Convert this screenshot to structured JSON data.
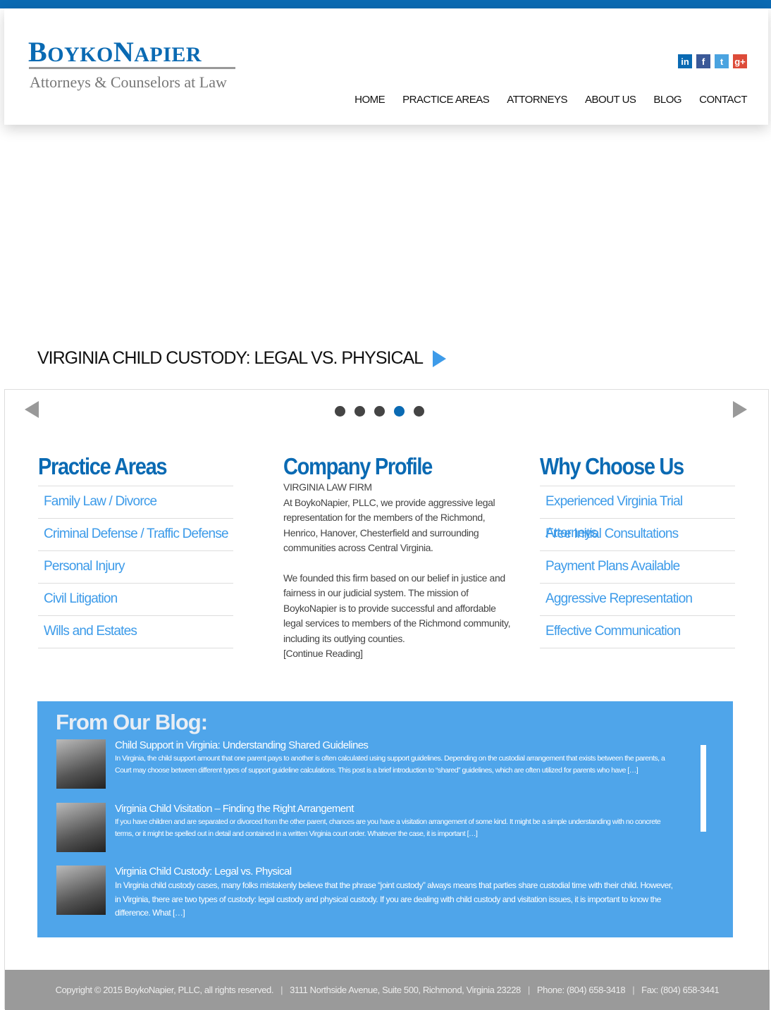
{
  "logo": {
    "name_b": "B",
    "name_oyko": "OYKO",
    "name_n": "N",
    "name_apier": "APIER",
    "tagline": "Attorneys & Counselors at Law"
  },
  "social": [
    {
      "name": "linkedin",
      "glyph": "in",
      "color": "#0a6ab3"
    },
    {
      "name": "facebook",
      "glyph": "f",
      "color": "#3b5998"
    },
    {
      "name": "twitter",
      "glyph": "t",
      "color": "#4aa3e0"
    },
    {
      "name": "google-plus",
      "glyph": "g+",
      "color": "#dd4b39"
    }
  ],
  "nav": [
    "HOME",
    "PRACTICE AREAS",
    "ATTORNEYS",
    "ABOUT US",
    "BLOG",
    "CONTACT"
  ],
  "slide": {
    "title": "VIRGINIA CHILD CUSTODY: LEGAL VS. PHYSICAL",
    "active_dot": 4,
    "dot_count": 5
  },
  "practice": {
    "title": "Practice Areas",
    "items": [
      "Family Law / Divorce",
      "Criminal Defense / Traffic Defense",
      "Personal Injury",
      "Civil Litigation",
      "Wills and Estates"
    ]
  },
  "profile": {
    "title": "Company Profile",
    "subtitle": "VIRGINIA LAW FIRM",
    "p1": "At BoykoNapier, PLLC, we provide aggressive legal representation for the members of the Richmond, Henrico, Hanover, Chesterfield and surrounding communities across Central Virginia.",
    "p2": "We founded this firm based on our belief in justice and fairness in our judicial system.  The mission of BoykoNapier is to provide successful and affordable legal services to members of the Richmond community, including its outlying counties.",
    "more": "[Continue Reading]"
  },
  "why": {
    "title": "Why Choose Us",
    "items": [
      "Experienced Virginia Trial Attorneys",
      "Free Initial Consultations",
      "Payment Plans Available",
      "Aggressive Representation",
      "Effective Communication"
    ]
  },
  "blog": {
    "title": "From Our Blog:",
    "posts": [
      {
        "title": "Child Support in Virginia: Understanding Shared Guidelines",
        "excerpt": "In Virginia, the child support amount that one parent pays to another is often calculated using support guidelines.  Depending on the custodial arrangement that exists between the parents, a Court may choose between different types of support guideline calculations. This post is a brief introduction to “shared” guidelines, which are often utilized for parents who have […]"
      },
      {
        "title": "Virginia Child Visitation – Finding the Right Arrangement",
        "excerpt": "If you have children and are separated or divorced from the other parent, chances are you have a visitation arrangement of some kind. It might be a simple understanding with no concrete terms, or it might be spelled out in detail and contained in a written Virginia court order. Whatever the case, it is important […]"
      },
      {
        "title": "Virginia Child Custody: Legal vs. Physical",
        "excerpt": "In Virginia child custody cases, many folks mistakenly believe that the phrase “joint custody” always means that parties share custodial time with their child.  However, in Virginia, there are two types of custody: legal custody and physical custody.  If you are dealing with child custody and visitation issues, it is important to know the difference. What […]"
      }
    ]
  },
  "footer": {
    "copyright": "Copyright © 2015 BoykoNapier, PLLC, all rights reserved.",
    "address": "3111 Northside Avenue, Suite 500, Richmond, Virginia 23228",
    "phone": "Phone: (804) 658-3418",
    "fax": "Fax: (804) 658-3441",
    "sep": "|"
  }
}
